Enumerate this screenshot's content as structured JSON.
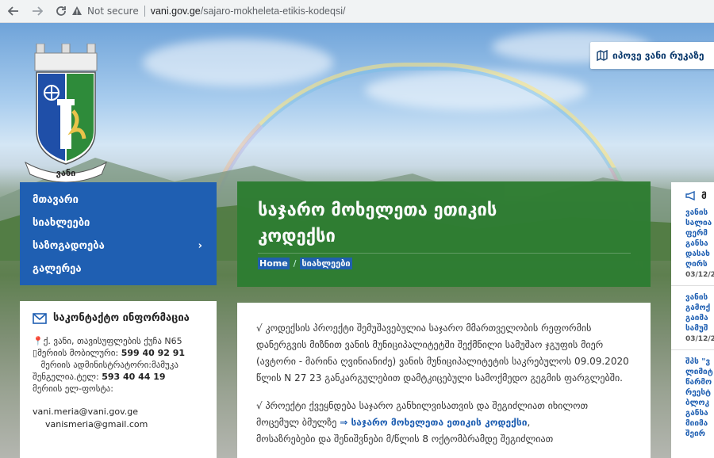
{
  "browser": {
    "security_label": "Not secure",
    "url_host": "vani.gov.ge",
    "url_path": "/sajaro-mokheleta-etikis-kodeqsi/"
  },
  "logo": {
    "town_name": "ვანი"
  },
  "map_button": {
    "label": "იპოვე ვანი რუკაზე"
  },
  "side_menu": {
    "items": [
      {
        "label": "მთავარი"
      },
      {
        "label": "სიახლეები"
      },
      {
        "label": "საზოგადოება"
      },
      {
        "label": "გალერეა"
      }
    ]
  },
  "page_header": {
    "title_line1": "საჯარო მოხელეთა ეთიკის",
    "title_line2": "კოდექსი",
    "breadcrumb_home": "Home",
    "breadcrumb_current": "სიახლეები"
  },
  "contact": {
    "title": "საკონტაქტო ინფორმაცია",
    "address": "ქ. ვანი, თავისუფლების ქუჩა N65",
    "phone_label": "მერიის მობილური:",
    "phone": "599 40 92 91",
    "admin_label": "მერიის ადმინისტრატორი:მამუკა",
    "admin_label2": "შენგელია.ტელ:",
    "admin_phone": "593 40 44 19",
    "email_label": "მერიის ელ-ფოსტა:",
    "email1": "vani.meria@vani.gov.ge",
    "email2": "vanismeria@gmail.com"
  },
  "content": {
    "para1": "√ კოდექსის პროექტი შემუშავებულია საჯარო მმართველობის რეფორმის დანერგვის მიზნით ვანის მუნიციპალიტეტში შექმნილი სამუშაო ჯგუფის მიერ (ავტორი - მარინა ღვინიანიძე) ვანის მუნიციპალიტეტის საკრებულოს 09.09.2020 წლის N 27 23 განკარგულებით დამტკიცებული სამოქმედო გეგმის ფარგლებში.",
    "para2_start": "√ პროექტი ქვეყნდება საჯარო განხილვისათვის და შეგიძლიათ იხილოთ მოცემულ ბმულზე",
    "para2_link": "⇒ საჯარო მოხელეთა ეთიკის კოდექსი",
    "para2_end": ",",
    "para3": "მოსაზრებები და შენიშვნები მ/წლის 8 ოქტომბრამდე შეგიძლიათ"
  },
  "news": {
    "title": "მ",
    "items": [
      {
        "text": "ვანის\nსალია\nფერმ\nგანსა\nდასახ\nღირს",
        "date": "03/12/2"
      },
      {
        "text": "ვანის\nგამოქ\nგაიმა\nსამუშ",
        "date": "03/12/2"
      },
      {
        "text": "შპს \"ვ\nლიმიტ\nწარმო\nრეესტ\nბლოკ\nგანსა\nმიიმა\nშეირ",
        "date": ""
      }
    ]
  }
}
